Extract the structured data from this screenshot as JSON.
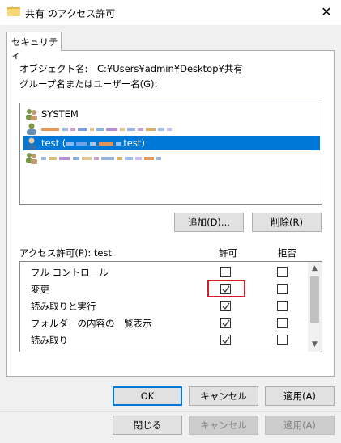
{
  "window": {
    "title": "共有 のアクセス許可",
    "close_glyph": "✕"
  },
  "tab": {
    "label": "セキュリティ"
  },
  "object": {
    "label": "オブジェクト名:",
    "value": "C:¥Users¥admin¥Desktop¥共有"
  },
  "group_label": "グループ名またはユーザー名(G):",
  "users": [
    {
      "text": "SYSTEM"
    },
    {
      "text": ""
    },
    {
      "text": "test (",
      "suffix": "test)"
    },
    {
      "text": ""
    }
  ],
  "buttons": {
    "add": "追加(D)...",
    "remove": "削除(R)"
  },
  "permissions": {
    "label": "アクセス許可(P): test",
    "allow_header": "許可",
    "deny_header": "拒否",
    "rows": [
      {
        "name": "フル コントロール",
        "allow": false,
        "deny": false
      },
      {
        "name": "変更",
        "allow": true,
        "deny": false
      },
      {
        "name": "読み取りと実行",
        "allow": true,
        "deny": false
      },
      {
        "name": "フォルダーの内容の一覧表示",
        "allow": true,
        "deny": false
      },
      {
        "name": "読み取り",
        "allow": true,
        "deny": false
      }
    ]
  },
  "dialog_buttons": {
    "ok": "OK",
    "cancel": "キャンセル",
    "apply": "適用(A)"
  },
  "bottom_buttons": {
    "close": "閉じる",
    "cancel": "キャンセル",
    "apply": "適用(A)"
  },
  "colors": {
    "selection": "#0078d7",
    "highlight_box": "#d21f2a",
    "default_button_border": "#0078d7"
  }
}
